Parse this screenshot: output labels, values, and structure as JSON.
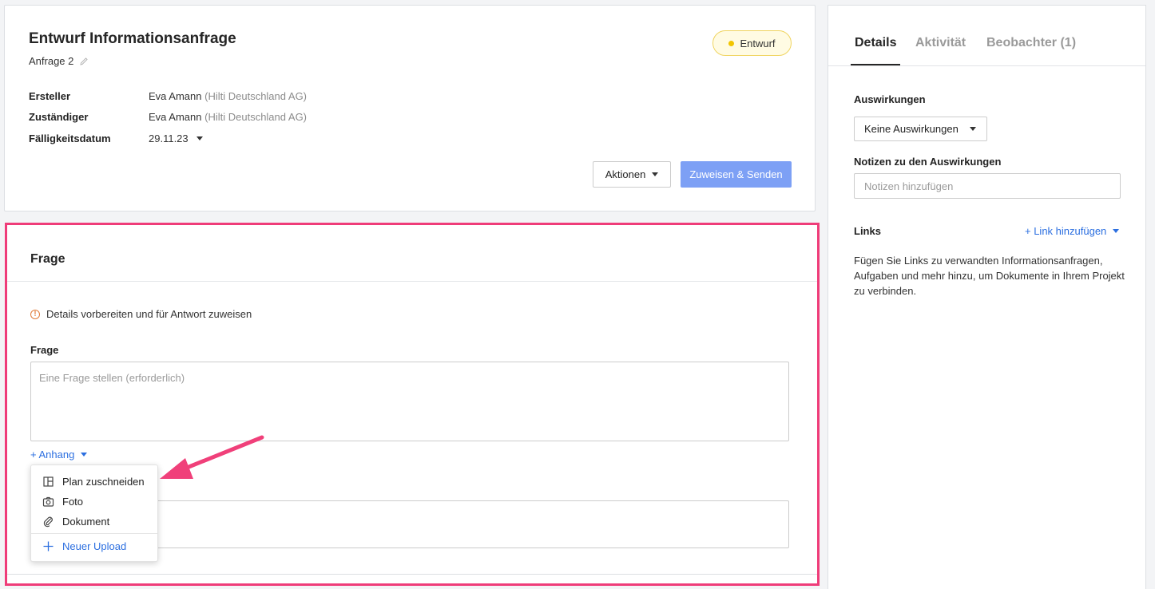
{
  "request": {
    "title": "Entwurf Informationsanfrage",
    "subtitle": "Anfrage 2",
    "status": "Entwurf",
    "fields": {
      "creator_label": "Ersteller",
      "creator_name": "Eva Amann",
      "creator_org": "(Hilti Deutschland AG)",
      "assignee_label": "Zuständiger",
      "assignee_name": "Eva Amann",
      "assignee_org": "(Hilti Deutschland AG)",
      "due_label": "Fälligkeitsdatum",
      "due_value": "29.11.23"
    },
    "actions_label": "Aktionen",
    "assign_label": "Zuweisen & Senden"
  },
  "question": {
    "section_title": "Frage",
    "info_text": "Details vorbereiten und für Antwort zuweisen",
    "field_label": "Frage",
    "placeholder": "Eine Frage stellen (erforderlich)",
    "attach_label": "+ Anhang"
  },
  "attach_menu": {
    "items": [
      {
        "label": "Plan zuschneiden",
        "icon": "crop-plan-icon"
      },
      {
        "label": "Foto",
        "icon": "camera-icon"
      },
      {
        "label": "Dokument",
        "icon": "paperclip-icon"
      }
    ],
    "upload_label": "Neuer Upload"
  },
  "sidebar": {
    "tabs": [
      {
        "label": "Details",
        "active": true
      },
      {
        "label": "Aktivität",
        "active": false
      },
      {
        "label": "Beobachter (1)",
        "active": false
      }
    ],
    "impact_label": "Auswirkungen",
    "impact_value": "Keine Auswirkungen",
    "notes_label": "Notizen zu den Auswirkungen",
    "notes_placeholder": "Notizen hinzufügen",
    "links_label": "Links",
    "links_add": "+ Link hinzufügen",
    "links_help": "Fügen Sie Links zu verwandten Informationsanfragen, Aufgaben und mehr hinzu, um Dokumente in Ihrem Projekt zu verbinden."
  },
  "colors": {
    "accent": "#2c6fe0",
    "highlight_border": "#ef3c79",
    "primary_button": "#7da0f5",
    "status_dot": "#f2c500"
  }
}
